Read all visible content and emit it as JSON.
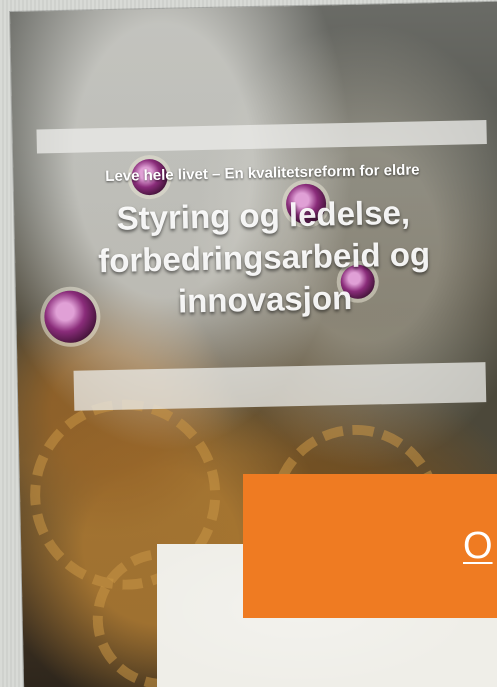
{
  "poster": {
    "top_strip_text": "",
    "subtitle": "Leve hele livet – En kvalitetsreform for eldre",
    "title_lines": [
      "Styring og ledelse,",
      "forbedringsarbeid og",
      "innovasjon"
    ],
    "footer_mark": ""
  },
  "cta": {
    "label": "O"
  },
  "colors": {
    "accent": "#ef7b22",
    "card": "#efeee8",
    "background": "#d6d8d4"
  }
}
